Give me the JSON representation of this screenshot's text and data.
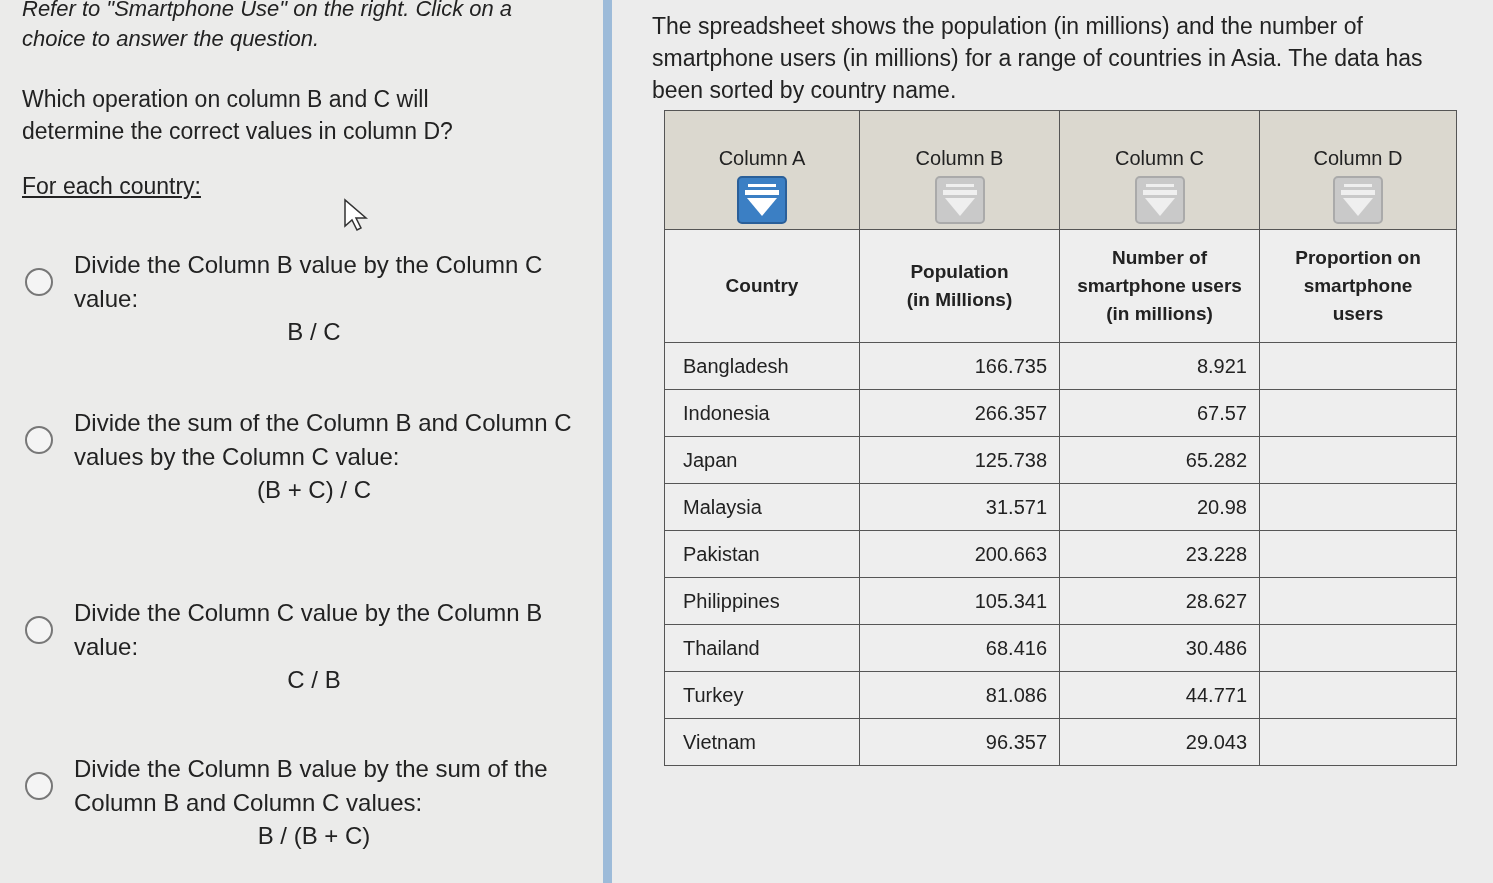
{
  "question_panel": {
    "instruction": "Refer to \"Smartphone Use\" on the right.  Click on a choice to answer the question.",
    "question": "Which operation on column B and C will determine the correct values in column D?",
    "lead": "For each country:",
    "choices": [
      {
        "text": "Divide the Column B value by the Column C value:",
        "formula": "B / C",
        "selected": false
      },
      {
        "text": "Divide the sum of the Column B and Column C values by the Column C value:",
        "formula": "(B + C) / C",
        "selected": false
      },
      {
        "text": "Divide the Column C value by the Column B value:",
        "formula": "C / B",
        "selected": false
      },
      {
        "text": "Divide the Column B value by the sum of the Column B and Column C values:",
        "formula": "B / (B + C)",
        "selected": false
      }
    ]
  },
  "data_panel": {
    "description": "The spreadsheet shows the population (in millions) and the number of smartphone users (in millions) for a range of countries in Asia. The data has been sorted by country name.",
    "table": {
      "columns": [
        {
          "label": "Column A",
          "filter_active": true,
          "heading": [
            "Country"
          ]
        },
        {
          "label": "Column B",
          "filter_active": false,
          "heading": [
            "Population",
            "(in Millions)"
          ]
        },
        {
          "label": "Column C",
          "filter_active": false,
          "heading": [
            "Number of",
            "smartphone users",
            "(in millions)"
          ]
        },
        {
          "label": "Column D",
          "filter_active": false,
          "heading": [
            "Proportion on",
            "smartphone",
            "users"
          ]
        }
      ],
      "rows": [
        {
          "country": "Bangladesh",
          "population": "166.735",
          "users": "8.921"
        },
        {
          "country": "Indonesia",
          "population": "266.357",
          "users": "67.57"
        },
        {
          "country": "Japan",
          "population": "125.738",
          "users": "65.282"
        },
        {
          "country": "Malaysia",
          "population": "31.571",
          "users": "20.98"
        },
        {
          "country": "Pakistan",
          "population": "200.663",
          "users": "23.228"
        },
        {
          "country": "Philippines",
          "population": "105.341",
          "users": "28.627"
        },
        {
          "country": "Thailand",
          "population": "68.416",
          "users": "30.486"
        },
        {
          "country": "Turkey",
          "population": "81.086",
          "users": "44.771"
        },
        {
          "country": "Vietnam",
          "population": "96.357",
          "users": "29.043"
        }
      ]
    }
  }
}
